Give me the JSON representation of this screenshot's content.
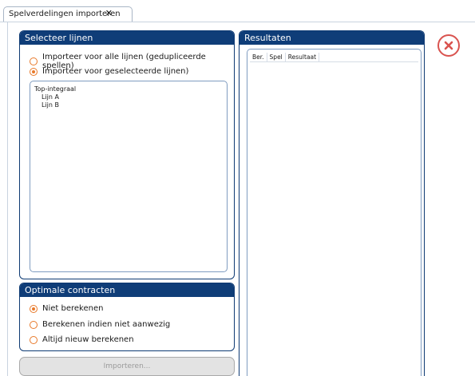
{
  "tab": {
    "title": "Spelverdelingen importeren",
    "close_glyph": "✕"
  },
  "panel_lijnen": {
    "header": "Selecteer lijnen",
    "options": [
      {
        "label": "Importeer voor alle lijnen (gedupliceerde spellen)",
        "selected": false
      },
      {
        "label": "Importeer voor geselecteerde lijnen)",
        "selected": true
      }
    ],
    "tree": [
      {
        "label": "Top-integraal",
        "level": 0
      },
      {
        "label": "Lijn A",
        "level": 1
      },
      {
        "label": "Lijn B",
        "level": 1
      }
    ]
  },
  "panel_results": {
    "header": "Resultaten",
    "columns": [
      "Ber.",
      "Spel",
      "Resultaat"
    ]
  },
  "panel_contract": {
    "header": "Optimale contracten",
    "options": [
      {
        "label": "Niet berekenen",
        "selected": true
      },
      {
        "label": "Berekenen indien niet aanwezig",
        "selected": false
      },
      {
        "label": "Altijd nieuw berekenen",
        "selected": false
      }
    ]
  },
  "import_button": {
    "label": "Importeren...",
    "enabled": false
  },
  "colors": {
    "header_bg": "#0f3d78",
    "accent": "#e8792a",
    "close": "#d9534f"
  },
  "icons": {
    "close_dialog": "close-circle-icon"
  }
}
